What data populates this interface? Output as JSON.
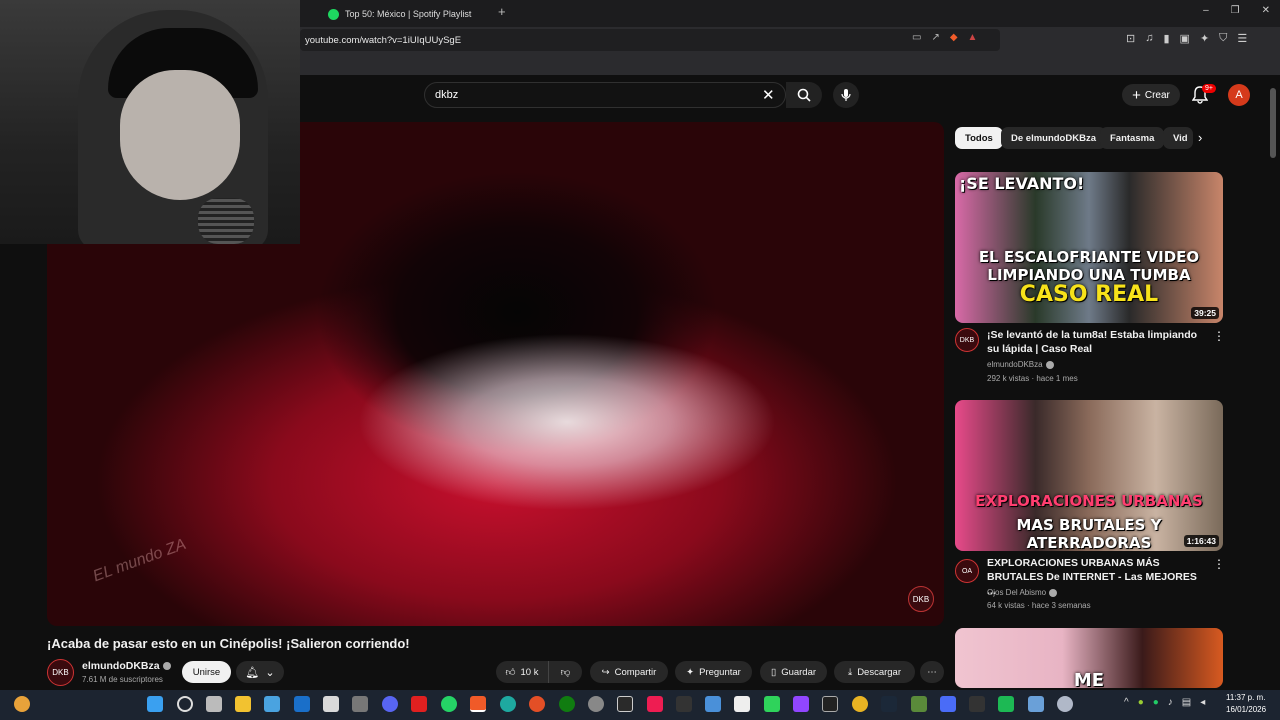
{
  "browser": {
    "tab_title": "Top 50: México | Spotify Playlist",
    "new_tab": "+",
    "url": "youtube.com/watch?v=1iUIqUUySgE",
    "window_controls": [
      "–",
      "❐",
      "✕"
    ]
  },
  "youtube": {
    "search_value": "dkbz",
    "create_label": "Crear",
    "notification_count": "9+",
    "account_initial": "A"
  },
  "video": {
    "title": "¡Acaba de pasar esto en un Cinépolis! ¡Salieron corriendo!",
    "watermark": "EL mundo ZA",
    "player_logo": "DKB",
    "channel": {
      "avatar_text": "DKB",
      "name": "elmundoDKBza",
      "subscribers": "7.61 M de suscriptores",
      "join_label": "Unirse"
    },
    "actions": {
      "likes": "10 k",
      "share": "Compartir",
      "ask": "Preguntar",
      "save": "Guardar",
      "download": "Descargar",
      "more": "⋯"
    }
  },
  "chips": [
    "Todos",
    "De elmundoDKBza",
    "Fantasma",
    "Vid"
  ],
  "related": [
    {
      "thumb_texts": [
        "¡SE LEVANTO!",
        "EL ESCALOFRIANTE VIDEO LIMPIANDO UNA TUMBA",
        "CASO REAL"
      ],
      "duration": "39:25",
      "title": "¡Se levantó de la tum8a! Estaba limpiando su lápida | Caso Real",
      "channel": "elmundoDKBza",
      "meta": "292 k vistas · hace 1 mes",
      "avatar_text": "DKB"
    },
    {
      "thumb_texts": [
        "EXPLORACIONES URBANAS",
        "MAS BRUTALES Y ATERRADORAS"
      ],
      "duration": "1:16:43",
      "title": "EXPLORACIONES URBANAS MÁS BRUTALES De INTERNET - Las MEJORES ...",
      "channel": "Ojos Del Abismo",
      "meta": "64 k vistas · hace 3 semanas",
      "avatar_text": "OA"
    },
    {
      "thumb_texts": [
        "ME"
      ]
    }
  ],
  "taskbar": {
    "time": "11:37 p. m.",
    "date": "16/01/2026",
    "tray_overflow": "^"
  },
  "colors": {
    "yt_background": "#0f0f0f",
    "spotify_green": "#1ed760",
    "notification_red": "#e00000",
    "avatar_orange": "#d53a1b"
  }
}
